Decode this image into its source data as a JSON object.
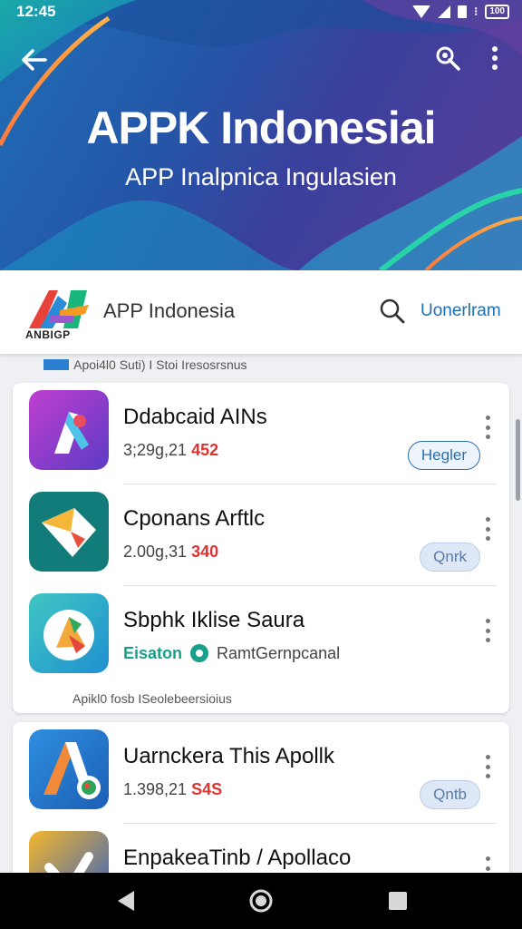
{
  "status_bar": {
    "time": "12:45",
    "icons": [
      "wifi-icon",
      "signal-icon",
      "sim-icon",
      "vibrate-icon",
      "battery-icon"
    ],
    "battery_label": "100"
  },
  "hero": {
    "title": "APPK Indonesiai",
    "subtitle": "APP Inalpnica Ingulasien",
    "back_icon": "arrow-left-icon",
    "action_icons": [
      "puzzle-icon",
      "more-vert-icon"
    ]
  },
  "app_header": {
    "logo_text": "ANBIGP",
    "name": "APP Indonesia",
    "search_icon": "search-icon",
    "link_label": "Uonerlram"
  },
  "sections": [
    {
      "caption": "Apoi4l0 Suti) I Stoi Iresosrsnus",
      "apps": [
        {
          "title": "Ddabcaid AINs",
          "meta_prefix": "3;29g,21",
          "meta_highlight": "452",
          "button": "Hegler",
          "button_style": "outline",
          "icon": "app-icon-purple"
        },
        {
          "title": "Cponans Arftlc",
          "meta_prefix": "2.00g,31",
          "meta_highlight": "340",
          "button": "Qnrk",
          "button_style": "soft",
          "icon": "app-icon-teal"
        },
        {
          "title": "Sbphk Iklise Saura",
          "meta_green": "Eisaton",
          "meta_suffix": "RamtGernpcanal",
          "button": "",
          "icon": "app-icon-cyan"
        }
      ]
    },
    {
      "caption": "Apikl0 fosb ISeolebeersioius",
      "apps": [
        {
          "title": "Uarnckera This Apollk",
          "meta_prefix": "1.398,21",
          "meta_highlight": "S4S",
          "button": "Qntb",
          "button_style": "soft",
          "icon": "app-icon-blue"
        },
        {
          "title": "EnpakeaTinb / Apollaco",
          "meta_prefix": "",
          "meta_highlight": "",
          "button": "",
          "icon": "app-icon-yellow"
        }
      ]
    }
  ],
  "nav_bar": {
    "icons": [
      "back-triangle-icon",
      "home-circle-icon",
      "recents-square-icon"
    ]
  },
  "colors": {
    "link_blue": "#1e6fb5",
    "highlight_red": "#d33333",
    "accent_green": "#17a08a"
  }
}
